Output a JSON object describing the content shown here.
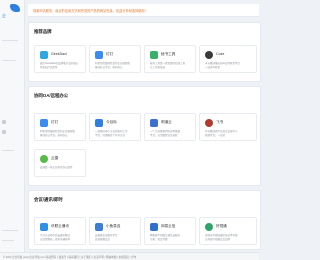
{
  "brand": {
    "logo_text": "企"
  },
  "sidebar": {
    "lines": [
      "",
      "",
      "",
      "",
      "",
      "",
      ""
    ]
  },
  "banner": {
    "text": "感谢申请服务，最近的应用方式和完成的产品的网站完善，欢迎分享和选择使用！"
  },
  "sections": [
    {
      "title": "推荐品牌",
      "tiles": [
        {
          "name": "GeekDaxi",
          "desc1": "展示GeekDaxi的品牌和产品的核心",
          "desc2": "特色和产品优势",
          "color": "#2fa7e0"
        },
        {
          "name": "钉钉",
          "desc1": "阿里巴巴集团打造的企业级智能",
          "desc2": "移动办公平台，协同办公",
          "color": "#3b8cf0"
        },
        {
          "name": "秘书工具",
          "desc1": "秘书工具是一款免费的在线工具",
          "desc2": "让工作更高效",
          "color": "#39b06a"
        },
        {
          "name": "Coze",
          "desc1": "字节跳动推出的AI应用开发平台",
          "desc2": "一站式AI开发",
          "color": "#3a3a3a"
        }
      ]
    },
    {
      "title": "协同OA/远程办公",
      "tiles": [
        {
          "name": "钉钉",
          "desc1": "阿里巴巴集团打造的企业级智能",
          "desc2": "移动办公平台，协同办公",
          "color": "#3b8cf0"
        },
        {
          "name": "今目标",
          "desc1": "一款面向中小企业的协同工作",
          "desc2": "平台，已经服务了众多企业",
          "color": "#2f7fe0"
        },
        {
          "name": "明道云",
          "desc1": "一个企业级零代码应用搭建",
          "desc2": "平台，灵活配置业务流程",
          "color": "#3b6fd0"
        },
        {
          "name": "飞书",
          "desc1": "字节跳动旗下先进企业协作与",
          "desc2": "管理平台，一站式",
          "color": "#b03a2e"
        },
        {
          "name": "云捷",
          "desc1": "云捷是一款企业协作办公软件",
          "desc2": "",
          "color": "#58b84a"
        }
      ]
    },
    {
      "title": "会议/通讯/即时",
      "tiles": [
        {
          "name": "讯联云通讯",
          "desc1": "专注企业协作的云通讯解决",
          "desc2": "方案提供商，提升沟通效率",
          "color": "#2f8fe0"
        },
        {
          "name": "小鱼易连",
          "desc1": "云视频会议服务平台",
          "desc2": "高清视频会议",
          "color": "#3a7fd5"
        },
        {
          "name": "网易云信",
          "desc1": "网易旗下的融合通信云服务",
          "desc2": "专家，稳定可靠",
          "color": "#2f6fd0"
        },
        {
          "name": "好视通",
          "desc1": "深圳市华视瑞通信息技术有限",
          "desc2": "公司旗下视频会议品牌",
          "color": "#2fa36a"
        }
      ]
    }
  ],
  "footer": {
    "text": "© 2024 企业导航 www.企业导航.com 版权所有 | 备案号 | 联系我们 | 关于我们 | 免责声明 | 网站地图 | 友情链接 | 合作"
  }
}
